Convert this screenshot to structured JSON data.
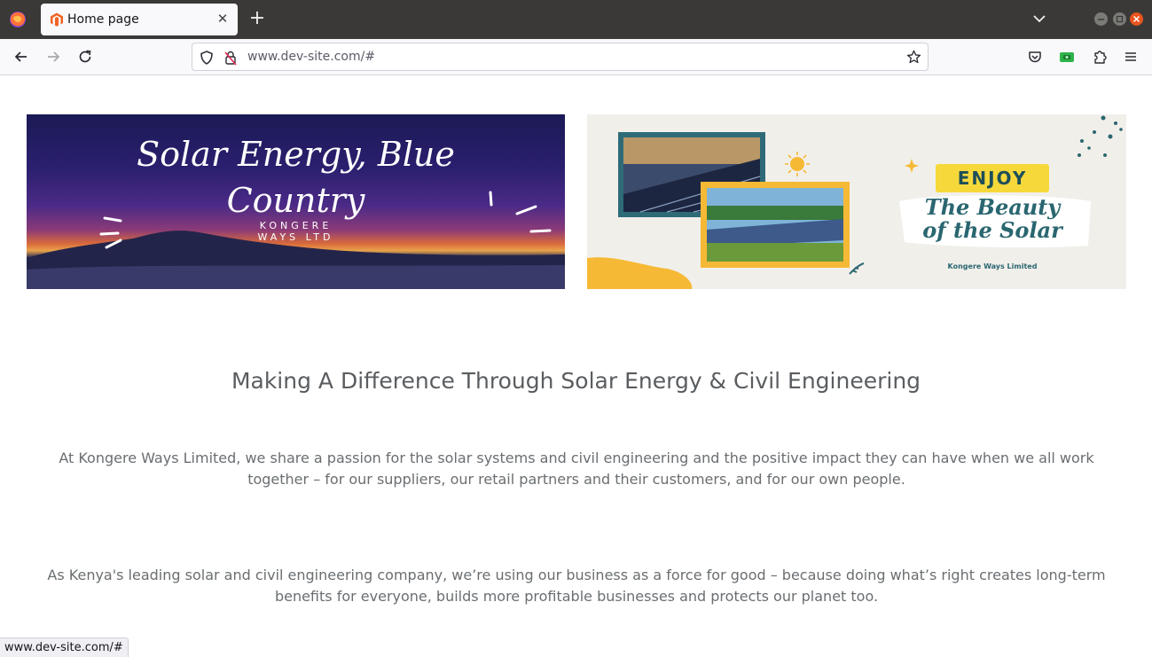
{
  "browser": {
    "tab_title": "Home page",
    "new_tab_symbol": "+",
    "tab_close_symbol": "✕",
    "url_host": "www.dev-site.com",
    "url_path": "/#",
    "status_url": "www.dev-site.com/#",
    "icons": [
      "firefox-logo",
      "magento-favicon",
      "back-arrow",
      "forward-arrow",
      "reload",
      "shield",
      "insecure-lock",
      "bookmark-star",
      "pocket",
      "extension-badge",
      "extensions-puzzle",
      "hamburger-menu",
      "chevron-down",
      "minimize",
      "maximize",
      "close"
    ],
    "colors": {
      "tabbar": "#3a3937",
      "toolbar": "#f9f9fb",
      "close_button": "#e9541f"
    }
  },
  "page": {
    "banner_left": {
      "title_line1": "Solar Energy, Blue",
      "title_line2": "Country",
      "subtitle_line1": "KONGERE",
      "subtitle_line2": "WAYS LTD"
    },
    "banner_right": {
      "enjoy": "ENJOY",
      "tagline_line1": "The Beauty",
      "tagline_line2": "of the Solar",
      "company": "Kongere Ways Limited"
    },
    "heading": "Making A Difference Through Solar Energy & Civil Engineering",
    "paragraph1": "At Kongere Ways Limited, we share a passion for the solar systems and civil engineering and the positive impact they can have when we all work together – for our suppliers, our retail partners and their customers, and for our own people.",
    "paragraph2": "As Kenya's leading solar and civil engineering company, we’re using our business as a force for good – because doing what’s right creates long-term benefits for everyone, builds more profitable businesses and protects our planet too.",
    "colors": {
      "heading": "#5a5d60",
      "text": "#6a6e71",
      "accent_yellow": "#f7d83a",
      "accent_teal": "#2a6670"
    }
  }
}
